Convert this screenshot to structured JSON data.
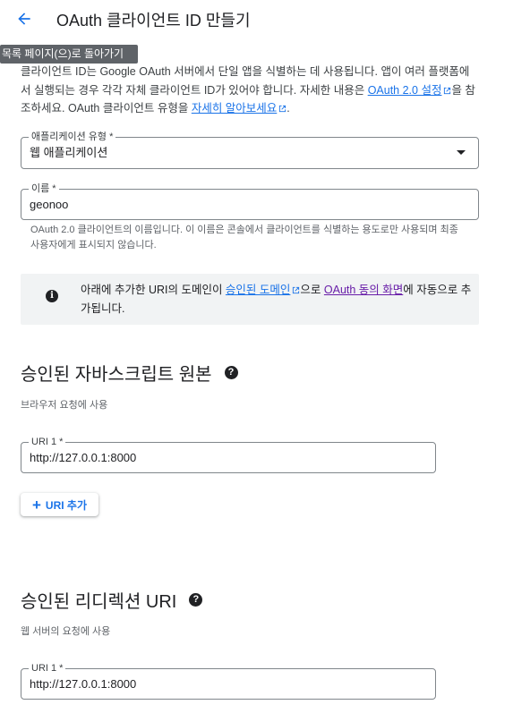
{
  "header": {
    "title": "OAuth 클라이언트 ID 만들기",
    "back_tooltip": "목록 페이지(으)로 돌아가기"
  },
  "intro": {
    "text_1": "클라이언트 ID는 Google OAuth 서버에서 단일 앱을 식별하는 데 사용됩니다. 앱이 여러 플랫폼에서 실행되는 경우 각각 자체 클라이언트 ID가 있어야 합니다. 자세한 내용은 ",
    "link_settings": "OAuth 2.0 설정",
    "text_2": "을 참조하세요. OAuth 클라이언트 유형을 ",
    "link_more": "자세히 알아보세요",
    "text_3": "."
  },
  "app_type": {
    "label": "애플리케이션 유형 *",
    "value": "웹 애플리케이션"
  },
  "name_field": {
    "label": "이름 *",
    "value": "geonoo",
    "hint": "OAuth 2.0 클라이언트의 이름입니다. 이 이름은 콘솔에서 클라이언트를 식별하는 용도로만 사용되며 최종 사용자에게 표시되지 않습니다."
  },
  "info_box": {
    "text_1": "아래에 추가한 URI의 도메인이 ",
    "link_domains": "승인된 도메인",
    "text_2": "으로 ",
    "link_consent": "OAuth 동의 화면",
    "text_3": "에 자동으로 추가됩니다."
  },
  "js_origins": {
    "title": "승인된 자바스크립트 원본",
    "subtitle": "브라우저 요청에 사용",
    "uri_label": "URI 1 *",
    "uri_value": "http://127.0.0.1:8000",
    "add_button": "URI 추가"
  },
  "redirect_uris": {
    "title": "승인된 리디렉션 URI",
    "subtitle": "웹 서버의 요청에 사용",
    "uri_label": "URI 1 *",
    "uri_value": "http://127.0.0.1:8000"
  },
  "colors": {
    "link": "#1a73e8",
    "visited_link": "#681da8",
    "info_bg": "#f1f3f4",
    "tooltip_bg": "#5f6368"
  },
  "icons": {
    "back": "arrow-back-icon",
    "external": "external-link-icon",
    "info": "info-icon",
    "help": "help-icon",
    "add": "plus-icon",
    "dropdown": "dropdown-arrow-icon"
  }
}
